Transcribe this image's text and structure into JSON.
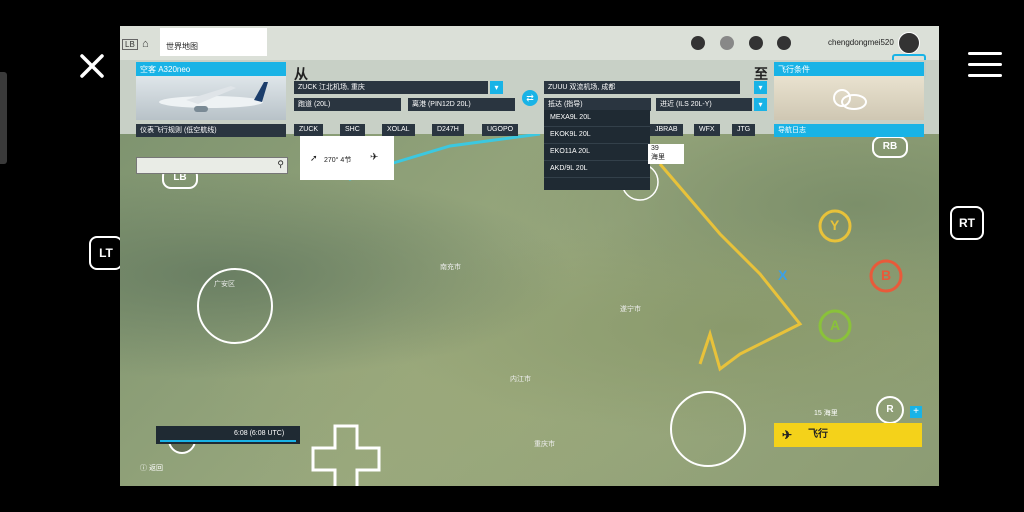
{
  "overlay": {
    "left_controls": [
      "LT",
      "LB"
    ],
    "right_controls": [
      "RT",
      "RB",
      "R"
    ],
    "face_buttons": [
      "Y",
      "X",
      "B",
      "A"
    ],
    "stick_left": "L"
  },
  "topbar": {
    "tab_lb": "LB",
    "world_map": "世界地图",
    "username": "chengdongmei520"
  },
  "aircraft": {
    "header": "空客 A320neo"
  },
  "route": {
    "from_label": "从",
    "to_label": "至",
    "from_airport": "ZUCK 江北机场, 重庆",
    "from_runway": "跑道 (20L)",
    "from_departure": "离港 (PIN12D 20L)",
    "to_airport": "ZUUU 双流机场, 成都",
    "to_arrival": "抵达 (指导)",
    "to_approach": "进近 (ILS 20L-Y)",
    "flight_plan": "仪表飞行规则 (低空航线)",
    "waypoints": [
      "ZUCK",
      "SHC",
      "XOLAL",
      "D247H",
      "UGOPO",
      "JBRAB",
      "WFX",
      "JTG"
    ]
  },
  "conditions": {
    "header": "飞行条件",
    "nav_log": "导航日志"
  },
  "arrival_dropdown": {
    "options": [
      "MEXA9L 20L",
      "EKOK9L 20L",
      "EKO11A 20L",
      "AKD/9L 20L"
    ]
  },
  "map": {
    "bubble_text": "270° 4节",
    "label_39": "39",
    "label_nm": "海里",
    "scale": "15 海里",
    "telemetry_time": "6:08 (6:08 UTC)",
    "fly_button": "飞行",
    "back": "返回",
    "colors": {
      "accent": "#19b3e6",
      "route_line": "#3cc8e0",
      "approach_line": "#e8c23a",
      "fly_button": "#f4d21a"
    },
    "place_labels": [
      "南充市",
      "遂宁市",
      "内江市",
      "广安区",
      "重庆市"
    ]
  }
}
